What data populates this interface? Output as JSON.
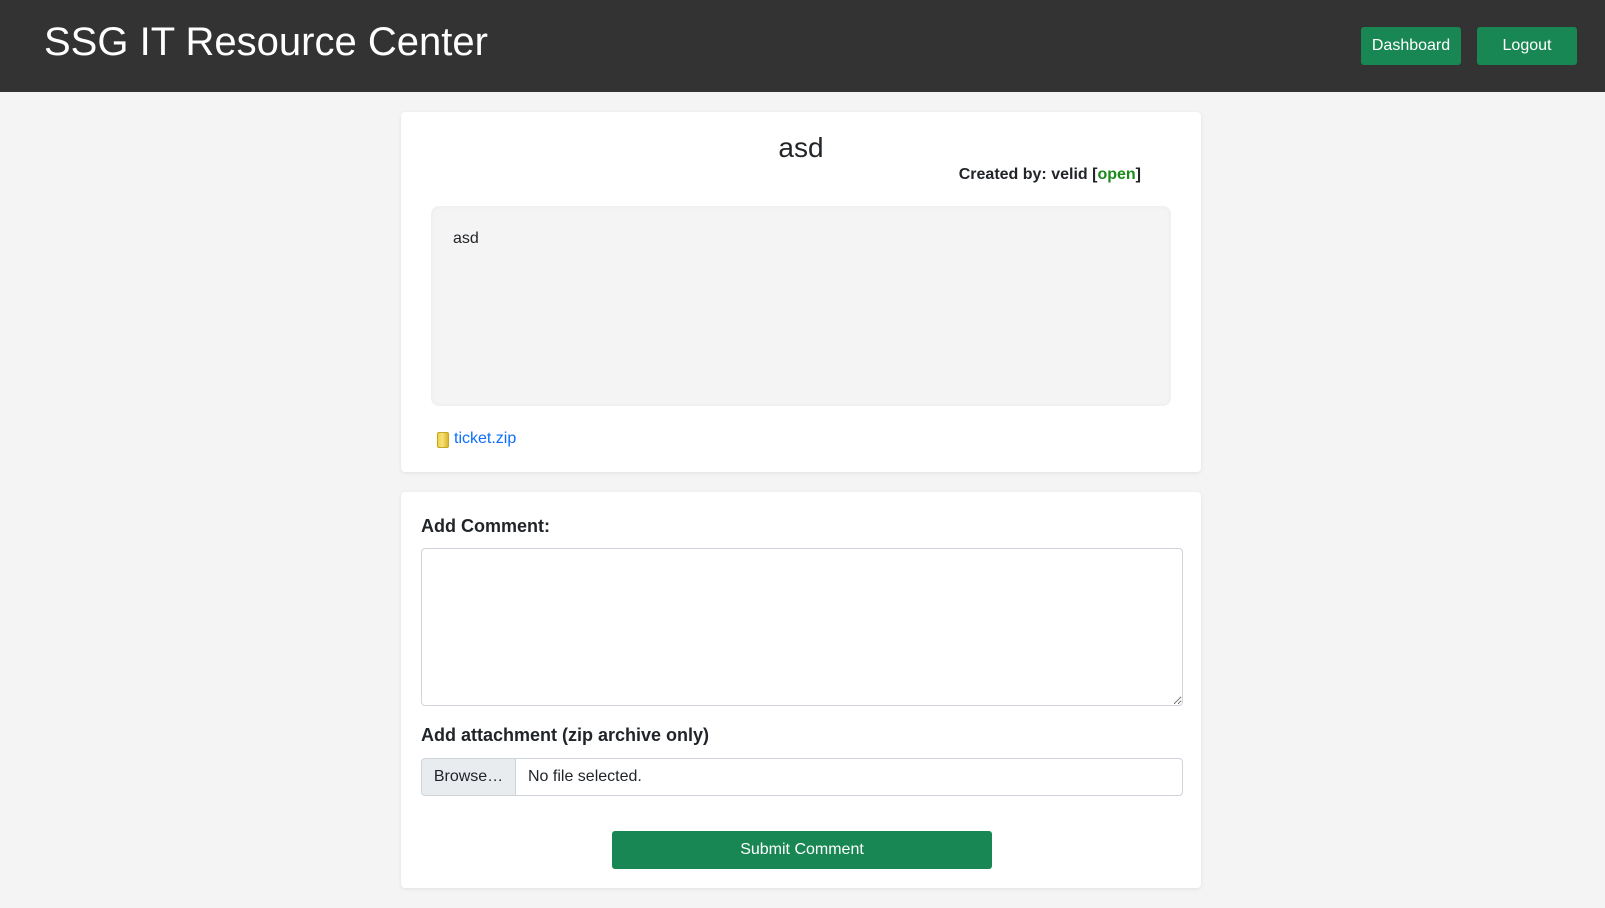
{
  "header": {
    "title": "SSG IT Resource Center",
    "dashboard_label": "Dashboard",
    "logout_label": "Logout"
  },
  "ticket": {
    "title": "asd",
    "created_by_prefix": "Created by: ",
    "author": "velid",
    "status_open_bracket": " [",
    "status": "open",
    "status_close_bracket": "]",
    "description": "asd",
    "attachment_name": "ticket.zip",
    "attachment_icon": "zip-file-icon"
  },
  "comment_form": {
    "comment_label": "Add Comment:",
    "comment_value": "",
    "attachment_label": "Add attachment (zip archive only)",
    "browse_label": "Browse…",
    "file_status": "No file selected.",
    "submit_label": "Submit Comment"
  },
  "colors": {
    "header_bg": "#333333",
    "button_green": "#198754",
    "status_open": "#1a8a1a",
    "link_blue": "#0d6efd"
  }
}
